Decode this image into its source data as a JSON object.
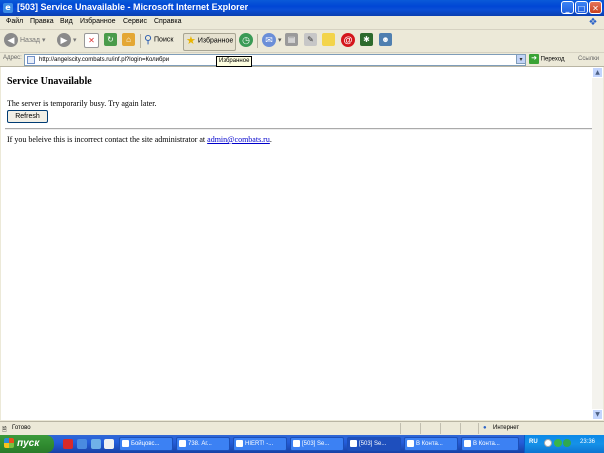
{
  "window": {
    "title": "[503] Service Unavailable - Microsoft Internet Explorer",
    "minimize_glyph": "_",
    "maximize_glyph": "□",
    "close_glyph": "✕"
  },
  "menu": [
    "Файл",
    "Правка",
    "Вид",
    "Избранное",
    "Сервис",
    "Справка"
  ],
  "toolbar": {
    "back_label": "Назад",
    "search_label": "Поиск",
    "favorites_label": "Избранное"
  },
  "address": {
    "label": "Адрес:",
    "url": "http://angelscity.combats.ru/inf.pl?login=Колибри",
    "go_label": "Переход",
    "links_label": "Ссылки"
  },
  "tooltip": "Избранное",
  "page": {
    "heading": "Service Unavailable",
    "message": "The server is temporarily busy. Try again later.",
    "refresh_label": "Refresh",
    "contact_text": "If you beleive this is incorrect contact the site administrator at",
    "contact_email": "admin@combats.ru",
    "contact_end": "."
  },
  "status": {
    "text": "Готово",
    "zone": "Интернет"
  },
  "taskbar": {
    "start_label": "пуск",
    "tasks": [
      "Бойцовс...",
      "738. Аг...",
      "HIERT! -...",
      "[503] Se...",
      "[503] Se...",
      "В Конта...",
      "В Конта..."
    ],
    "active_task": 4,
    "lang": "RU",
    "clock": "23:36"
  },
  "colors": {
    "titlebar": "#0046d5",
    "taskbar": "#245edb",
    "start": "#3c9a3c",
    "link": "#0000cc"
  }
}
